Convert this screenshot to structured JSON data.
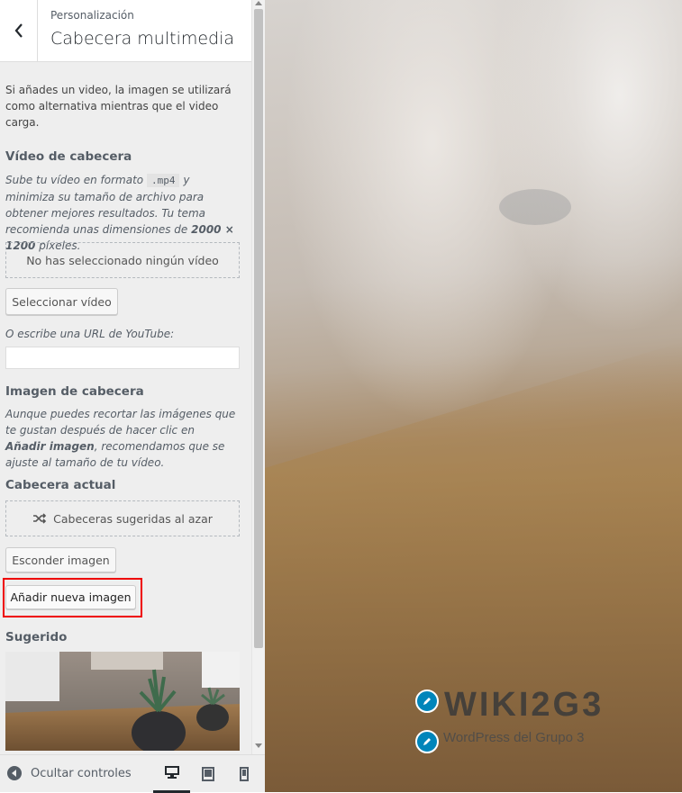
{
  "header": {
    "breadcrumb": "Personalización",
    "title": "Cabecera multimedia"
  },
  "intro": "Si añades un video, la imagen se utilizará como alternativa mientras que el video carga.",
  "video": {
    "heading": "Vídeo de cabecera",
    "desc_part1": "Sube tu vídeo en formato",
    "format": ".mp4",
    "desc_part2": "y minimiza su tamaño de archivo para obtener mejores resultados. Tu tema recomienda unas dimensiones de",
    "dimensions": "2000 × 1200",
    "desc_part3": "píxeles.",
    "no_selection": "No has seleccionado ningún vídeo",
    "select_button": "Seleccionar vídeo",
    "youtube_label": "O escribe una URL de YouTube:",
    "youtube_value": ""
  },
  "image": {
    "heading": "Imagen de cabecera",
    "desc_part1": "Aunque puedes recortar las imágenes que te gustan después de hacer clic en",
    "desc_bold": "Añadir imagen",
    "desc_part2": ", recomendamos que se ajuste al tamaño de tu vídeo.",
    "current_heading": "Cabecera actual",
    "random_label": "Cabeceras sugeridas al azar",
    "hide_button": "Esconder imagen",
    "add_button": "Añadir nueva imagen",
    "suggested_heading": "Sugerido"
  },
  "footer": {
    "hide_controls": "Ocultar controles",
    "devices": [
      "desktop-icon",
      "tablet-icon",
      "mobile-icon"
    ]
  },
  "preview": {
    "site_title": "WIKI2G3",
    "tagline": "WordPress del Grupo 3"
  },
  "colors": {
    "accent": "#0085ba",
    "highlight": "#e00000"
  }
}
